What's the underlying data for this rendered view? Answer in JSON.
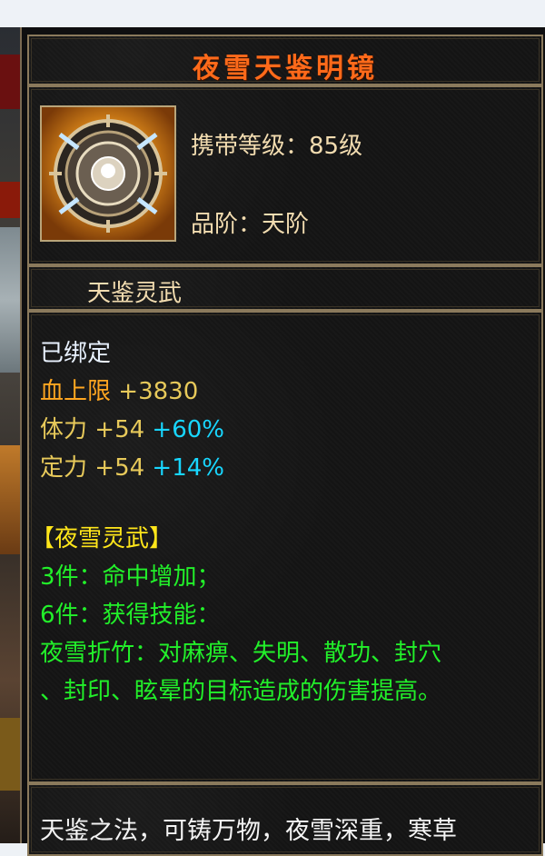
{
  "item": {
    "name": "夜雪天鉴明镜",
    "carry_level_label": "携带等级：",
    "carry_level_value": "85级",
    "grade_label": "品阶：",
    "grade_value": "天阶",
    "subtype": "天鉴灵武",
    "icon": "mirror-weapon-icon"
  },
  "attributes": {
    "bound": "已绑定",
    "hp_label": "血上限",
    "hp_value": "+3830",
    "stamina_label": "体力",
    "stamina_value": "+54",
    "stamina_pct": "+60%",
    "focus_label": "定力",
    "focus_value": "+54",
    "focus_pct": "+14%"
  },
  "set": {
    "name": "【夜雪灵武】",
    "bonus3": "3件：命中增加；",
    "bonus6": "6件：获得技能：",
    "skill_line1": "夜雪折竹：对麻痹、失明、散功、封穴",
    "skill_line2": "、封印、眩晕的目标造成的伤害提高。"
  },
  "description": "天鉴之法，可铸万物，夜雪深重，寒草",
  "colors": {
    "title": "#ff6a1a",
    "bound": "#e9f2ff",
    "hp": "#ffa620",
    "stat": "#e7c95a",
    "percent": "#18d6ff",
    "set_name": "#ffe61a",
    "set_text": "#22f02a"
  }
}
